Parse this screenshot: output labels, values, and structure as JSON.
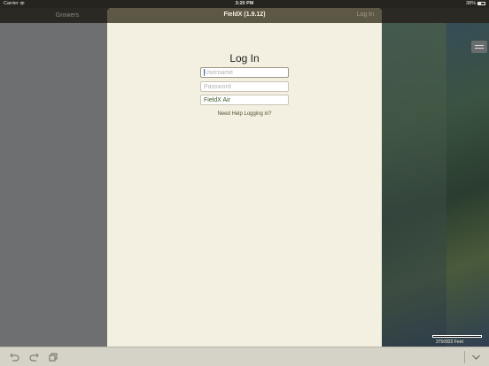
{
  "status_bar": {
    "carrier": "Carrier",
    "time": "3:20 PM",
    "battery": "38%"
  },
  "nav": {
    "growers_label": "Growers"
  },
  "modal": {
    "title": "FieldX (1.9.12)",
    "login_button": "Log In",
    "heading": "Log In",
    "username_placeholder": "Username",
    "password_placeholder": "Password",
    "server_value": "FieldX Air",
    "help_link": "Need Help Logging in?"
  },
  "map": {
    "scale_label": "3750922 Feet",
    "layers_icon": "layers-icon"
  },
  "toolbar": {
    "icons": [
      "undo-icon",
      "redo-icon",
      "duplicate-icon",
      "chevron-down-icon"
    ]
  },
  "colors": {
    "header_bg": "#5d5746",
    "modal_bg": "#f3efe1",
    "server_text": "#3d5a25",
    "toolbar_bg": "#d5d2c7"
  }
}
